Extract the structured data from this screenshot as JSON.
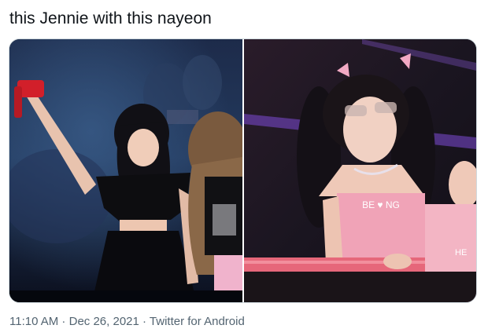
{
  "tweet": {
    "text": "this Jennie with this nayeon",
    "media": [
      {
        "icon": "concert-photo-jennie"
      },
      {
        "icon": "concert-photo-nayeon",
        "shirt_text": "BE ♥ NG",
        "shirt_text_2": "HE"
      }
    ],
    "time": "11:10 AM",
    "separator": " · ",
    "date": "Dec 26, 2021",
    "source": "Twitter for Android"
  }
}
